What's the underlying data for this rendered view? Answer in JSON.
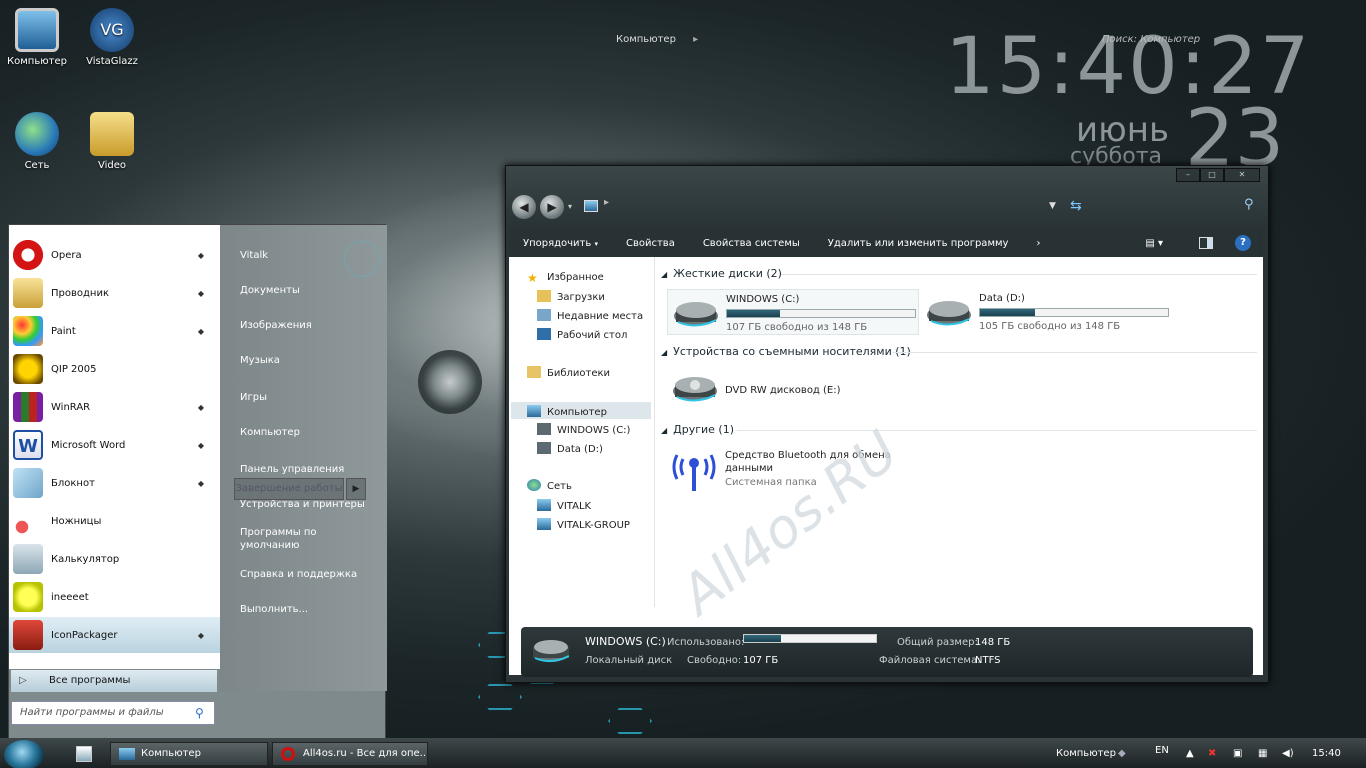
{
  "desktop": {
    "icons": [
      {
        "label": "Компьютер"
      },
      {
        "label": "VistaGlazz"
      },
      {
        "label": "Сеть"
      },
      {
        "label": "Video"
      }
    ],
    "clock": {
      "time": "15:40:27",
      "month": "июнь",
      "weekday": "суббота",
      "day": "23"
    },
    "watermark": "All4os.RU"
  },
  "explorer": {
    "address": "Компьютер",
    "search_placeholder": "Поиск: Компьютер",
    "toolbar": {
      "organize": "Упорядочить",
      "properties": "Свойства",
      "system_properties": "Свойства системы",
      "uninstall": "Удалить или изменить программу"
    },
    "nav": {
      "favorites": "Избранное",
      "downloads": "Загрузки",
      "recent": "Недавние места",
      "desktop": "Рабочий стол",
      "libraries": "Библиотеки",
      "computer": "Компьютер",
      "drive_c": "WINDOWS (C:)",
      "drive_d": "Data (D:)",
      "network": "Сеть",
      "net1": "VITALK",
      "net2": "VITALK-GROUP"
    },
    "groups": {
      "hdd": "Жесткие диски (2)",
      "removable": "Устройства со съемными носителями (1)",
      "other": "Другие (1)"
    },
    "drives": [
      {
        "name": "WINDOWS (C:)",
        "free_text": "107 ГБ свободно из 148 ГБ",
        "used_fraction": 0.28
      },
      {
        "name": "Data (D:)",
        "free_text": "105 ГБ свободно из 148 ГБ",
        "used_fraction": 0.29
      }
    ],
    "dvd": "DVD RW дисковод (E:)",
    "bluetooth": {
      "line1": "Средство Bluetooth для обмена",
      "line2": "данными",
      "type": "Системная папка"
    },
    "details": {
      "name": "WINDOWS (C:)",
      "type": "Локальный диск",
      "used_label": "Использовано:",
      "used_fraction": 0.28,
      "free_label": "Свободно:",
      "free_value": "107 ГБ",
      "total_label": "Общий размер:",
      "total_value": "148 ГБ",
      "fs_label": "Файловая система:",
      "fs_value": "NTFS"
    }
  },
  "startmenu": {
    "programs": [
      {
        "label": "Opera",
        "arrow": true
      },
      {
        "label": "Проводник",
        "arrow": true
      },
      {
        "label": "Paint",
        "arrow": true
      },
      {
        "label": "QIP 2005",
        "arrow": false
      },
      {
        "label": "WinRAR",
        "arrow": true
      },
      {
        "label": "Microsoft Word",
        "arrow": true
      },
      {
        "label": "Блокнот",
        "arrow": true
      },
      {
        "label": "Ножницы",
        "arrow": false
      },
      {
        "label": "Калькулятор",
        "arrow": false
      },
      {
        "label": "ineeeet",
        "arrow": false
      },
      {
        "label": "IconPackager",
        "arrow": true
      }
    ],
    "all_programs": "Все программы",
    "search_placeholder": "Найти программы и файлы",
    "right": {
      "user": "Vitalk",
      "documents": "Документы",
      "pictures": "Изображения",
      "music": "Музыка",
      "games": "Игры",
      "computer": "Компьютер",
      "control_panel": "Панель управления",
      "devices": "Устройства и принтеры",
      "defaults1": "Программы по",
      "defaults2": "умолчанию",
      "help": "Справка и поддержка",
      "run": "Выполнить...",
      "shutdown": "Завершение работы"
    }
  },
  "taskbar": {
    "task1": "Компьютер",
    "task2": "All4os.ru - Все для опе...",
    "tray_computer": "Компьютер",
    "lang": "EN",
    "time": "15:40"
  },
  "colors": {
    "accent": "#2fc6e6",
    "bar": "#1a4150"
  }
}
